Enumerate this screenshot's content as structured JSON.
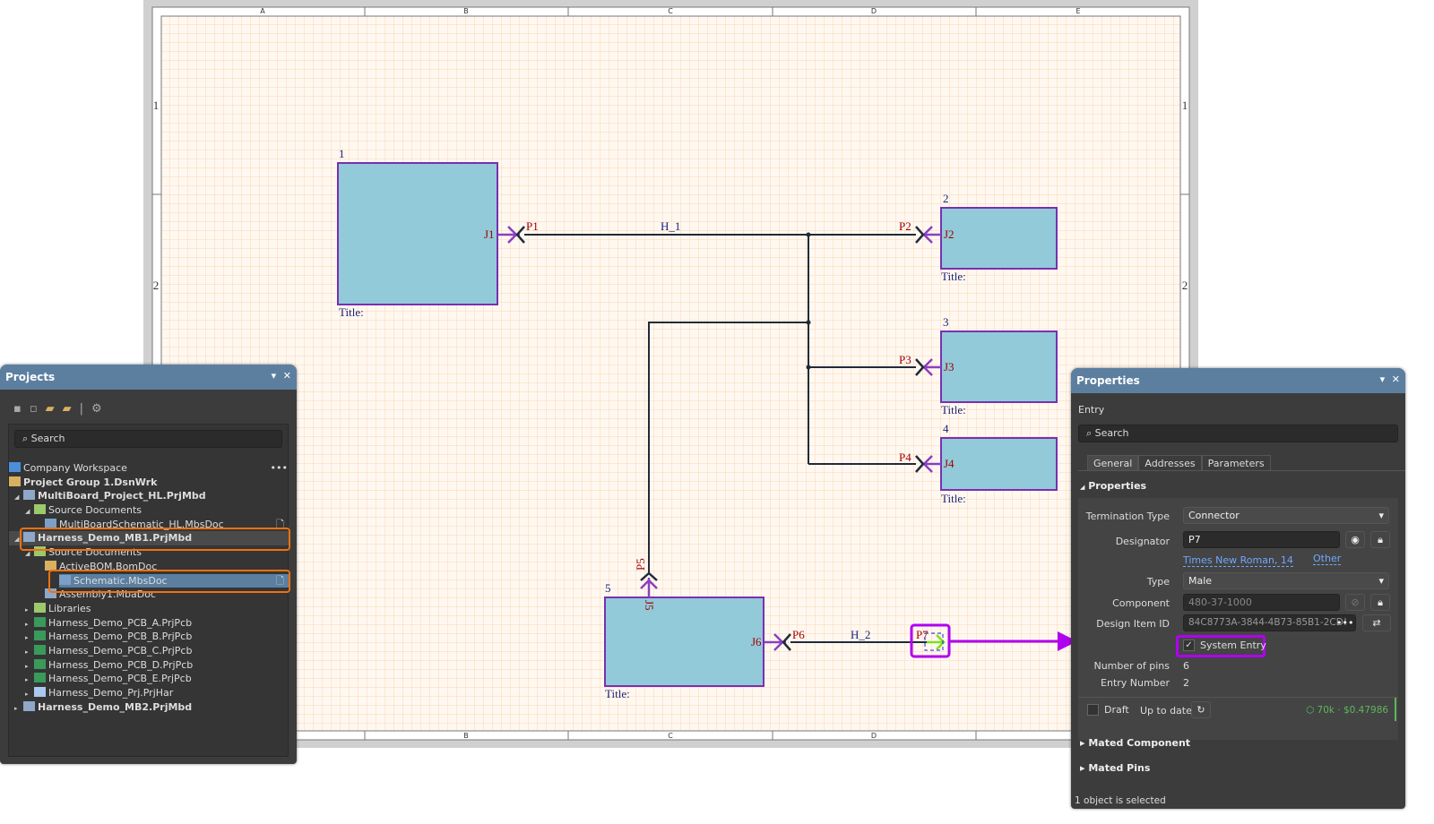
{
  "sheet": {
    "zones_top": [
      "A",
      "B",
      "C",
      "D",
      "E"
    ],
    "zones_bottom": [
      "B",
      "C",
      "D"
    ],
    "rows": [
      "1",
      "2"
    ],
    "blocks": [
      {
        "num": "1",
        "title": "Title:",
        "entry": "J1"
      },
      {
        "num": "2",
        "title": "Title:",
        "entry": "J2"
      },
      {
        "num": "3",
        "title": "Title:",
        "entry": "J3"
      },
      {
        "num": "4",
        "title": "Title:",
        "entry": "J4"
      },
      {
        "num": "5",
        "title": "Title:",
        "entry": "J5",
        "entry2": "J6"
      }
    ],
    "ports": [
      "P1",
      "P2",
      "P3",
      "P4",
      "P5",
      "P6",
      "P7"
    ],
    "harnesses": [
      "H_1",
      "H_2"
    ],
    "colors": {
      "block_fill": "#92cad9",
      "block_border": "#7a2fb0",
      "grid": "#f7c9a0",
      "wire": "#1f2b3a",
      "port_text": "#a00000",
      "highlight": "#b000f0"
    }
  },
  "projects": {
    "title": "Projects",
    "search_placeholder": "Search",
    "items": [
      {
        "label": "Company Workspace",
        "level": 0
      },
      {
        "label": "Project Group 1.DsnWrk",
        "level": 0
      },
      {
        "label": "MultiBoard_Project_HL.PrjMbd",
        "level": 1
      },
      {
        "label": "Source Documents",
        "level": 2
      },
      {
        "label": "MultiBoardSchematic_HL.MbsDoc",
        "level": 3
      },
      {
        "label": "Harness_Demo_MB1.PrjMbd",
        "level": 1
      },
      {
        "label": "Source Documents",
        "level": 2
      },
      {
        "label": "ActiveBOM.BomDoc",
        "level": 3
      },
      {
        "label": "Schematic.MbsDoc",
        "level": 3
      },
      {
        "label": "Assembly1.MbaDoc",
        "level": 3
      },
      {
        "label": "Libraries",
        "level": 2
      },
      {
        "label": "Harness_Demo_PCB_A.PrjPcb",
        "level": 2
      },
      {
        "label": "Harness_Demo_PCB_B.PrjPcb",
        "level": 2
      },
      {
        "label": "Harness_Demo_PCB_C.PrjPcb",
        "level": 2
      },
      {
        "label": "Harness_Demo_PCB_D.PrjPcb",
        "level": 2
      },
      {
        "label": "Harness_Demo_PCB_E.PrjPcb",
        "level": 2
      },
      {
        "label": "Harness_Demo_Prj.PrjHar",
        "level": 2
      },
      {
        "label": "Harness_Demo_MB2.PrjMbd",
        "level": 1
      }
    ]
  },
  "properties": {
    "title": "Properties",
    "object_type": "Entry",
    "search_placeholder": "Search",
    "tabs": [
      "General",
      "Addresses",
      "Parameters"
    ],
    "section": "Properties",
    "termination_type_label": "Termination Type",
    "termination_type": "Connector",
    "designator_label": "Designator",
    "designator": "P7",
    "font_link": "Times New Roman, 14",
    "other_link": "Other",
    "type_label": "Type",
    "type": "Male",
    "component_label": "Component",
    "component": "480-37-1000",
    "design_item_label": "Design Item ID",
    "design_item": "84C8773A-3844-4B73-85B1-2CD!",
    "system_entry": "System Entry",
    "system_entry_checked": true,
    "pins_label": "Number of pins",
    "pins": "6",
    "entry_number_label": "Entry Number",
    "entry_number": "2",
    "draft": "Draft",
    "draft_checked": false,
    "up_to_date": "Up to date",
    "price": "70k · $0.47986",
    "mated_component": "Mated Component",
    "mated_pins": "Mated Pins",
    "status": "1 object is selected"
  }
}
